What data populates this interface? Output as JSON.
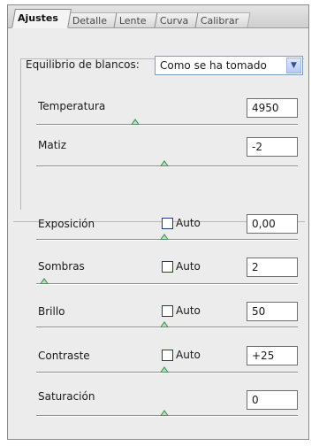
{
  "tabs": [
    {
      "label": "Ajustes",
      "active": true
    },
    {
      "label": "Detalle",
      "active": false
    },
    {
      "label": "Lente",
      "active": false
    },
    {
      "label": "Curva",
      "active": false
    },
    {
      "label": "Calibrar",
      "active": false
    }
  ],
  "white_balance": {
    "label": "Equilibrio de blancos:",
    "value": "Como se ha tomado"
  },
  "sliders": {
    "temperatura": {
      "label": "Temperatura",
      "value": "4950",
      "level": 0.38
    },
    "matiz": {
      "label": "Matiz",
      "value": "-2",
      "level": 0.49
    },
    "exposicion": {
      "label": "Exposición",
      "value": "0,00",
      "level": 0.49,
      "auto_label": "Auto",
      "auto": false
    },
    "sombras": {
      "label": "Sombras",
      "value": "2",
      "level": 0.03,
      "auto_label": "Auto",
      "auto": false
    },
    "brillo": {
      "label": "Brillo",
      "value": "50",
      "level": 0.49,
      "auto_label": "Auto",
      "auto": false
    },
    "contraste": {
      "label": "Contraste",
      "value": "+25",
      "level": 0.49,
      "auto_label": "Auto",
      "auto": false
    },
    "saturacion": {
      "label": "Saturación",
      "value": "0",
      "level": 0.49
    }
  },
  "colors": {
    "accent": "#4f8f5e",
    "field_border": "#7f9db9"
  }
}
